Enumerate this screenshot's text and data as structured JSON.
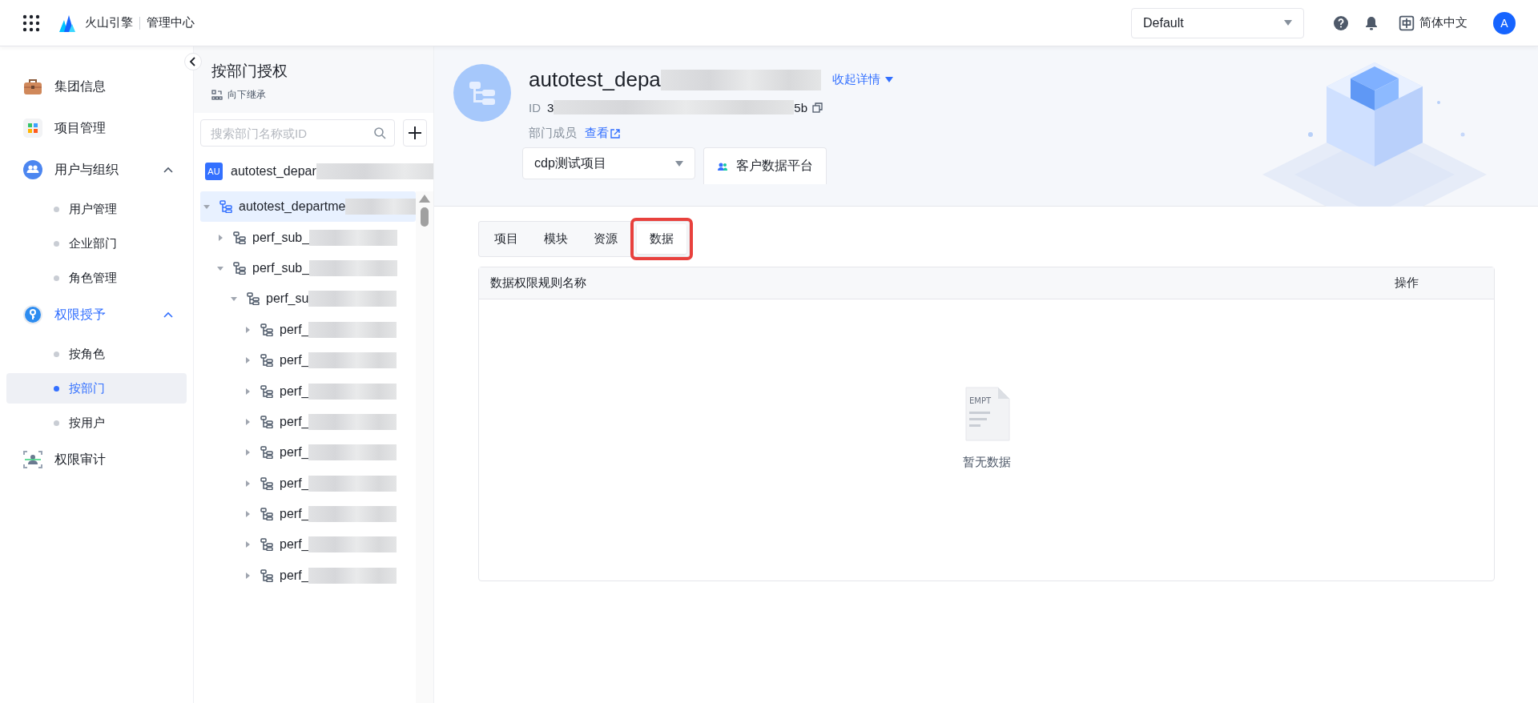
{
  "top_bar": {
    "brand": "火山引擎",
    "product": "管理中心",
    "workspace_select": {
      "value": "Default"
    },
    "language": "简体中文",
    "avatar": "A"
  },
  "sidebar": {
    "items": [
      {
        "kind": "item",
        "label": "集团信息",
        "active": false
      },
      {
        "kind": "item",
        "label": "项目管理",
        "active": false
      },
      {
        "kind": "group",
        "label": "用户与组织",
        "active": false,
        "expanded": true,
        "children": [
          {
            "label": "用户管理",
            "selected": false
          },
          {
            "label": "企业部门",
            "selected": false
          },
          {
            "label": "角色管理",
            "selected": false
          }
        ]
      },
      {
        "kind": "group",
        "label": "权限授予",
        "active": true,
        "expanded": true,
        "children": [
          {
            "label": "按角色",
            "selected": false
          },
          {
            "label": "按部门",
            "selected": true
          },
          {
            "label": "按用户",
            "selected": false
          }
        ]
      },
      {
        "kind": "item",
        "label": "权限审计",
        "active": false
      }
    ]
  },
  "dept_panel": {
    "title": "按部门授权",
    "inherit": "向下继承",
    "search": {
      "placeholder": "搜索部门名称或ID"
    },
    "root": {
      "badge": "AU",
      "name": "autotest_depar"
    },
    "tree": [
      {
        "name": "autotest_departme",
        "expanded": true,
        "selected": true,
        "children": [
          {
            "name": "perf_sub_",
            "expanded": false,
            "selected": false
          },
          {
            "name": "perf_sub_",
            "expanded": true,
            "selected": false,
            "children": [
              {
                "name": "perf_su",
                "expanded": true,
                "selected": false,
                "children": [
                  {
                    "name": "perf_",
                    "expanded": false,
                    "selected": false
                  },
                  {
                    "name": "perf_",
                    "expanded": false,
                    "selected": false
                  },
                  {
                    "name": "perf_",
                    "expanded": false,
                    "selected": false
                  },
                  {
                    "name": "perf_",
                    "expanded": false,
                    "selected": false
                  },
                  {
                    "name": "perf_",
                    "expanded": false,
                    "selected": false
                  },
                  {
                    "name": "perf_",
                    "expanded": false,
                    "selected": false
                  },
                  {
                    "name": "perf_",
                    "expanded": false,
                    "selected": false
                  },
                  {
                    "name": "perf_",
                    "expanded": false,
                    "selected": false
                  },
                  {
                    "name": "perf_",
                    "expanded": false,
                    "selected": false
                  }
                ]
              }
            ]
          }
        ]
      }
    ]
  },
  "department": {
    "name": "autotest_depa",
    "collapse_link": "收起详情",
    "id_label": "ID",
    "id_start": "3",
    "id_end": "5b",
    "members_label": "部门成员",
    "members_link": "查看"
  },
  "project_select": {
    "value": "cdp测试项目"
  },
  "product_tabs": [
    {
      "label": "客户数据平台",
      "selected": true
    }
  ],
  "sub_tabs": [
    {
      "label": "项目",
      "selected": false,
      "highlighted": false
    },
    {
      "label": "模块",
      "selected": false,
      "highlighted": false
    },
    {
      "label": "资源",
      "selected": false,
      "highlighted": false
    },
    {
      "label": "数据",
      "selected": true,
      "highlighted": true
    }
  ],
  "table": {
    "columns": [
      "数据权限规则名称",
      "操作"
    ],
    "empty": {
      "icon_text": "EMPT",
      "text": "暂无数据"
    }
  }
}
